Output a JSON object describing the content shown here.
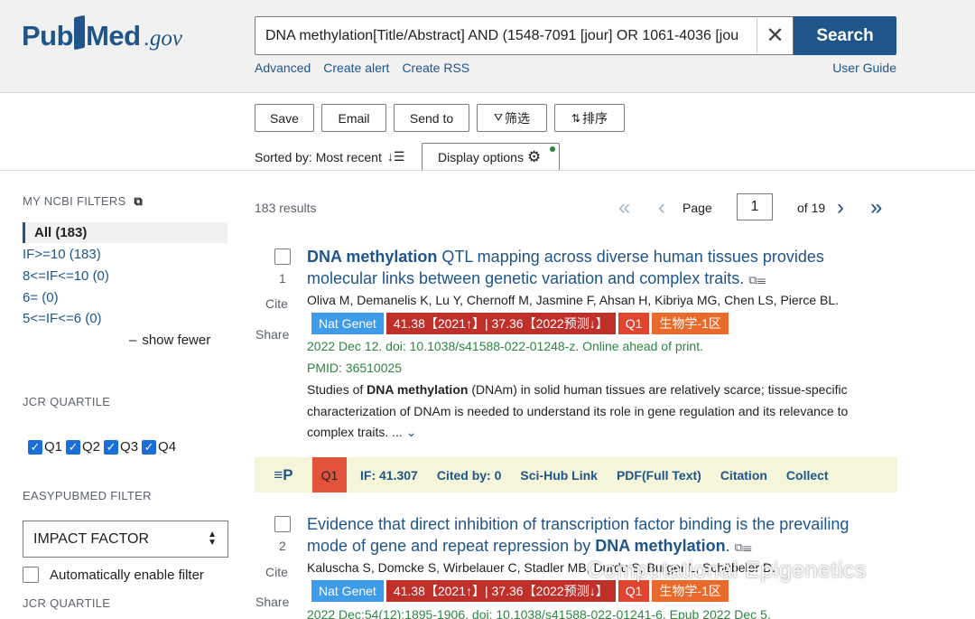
{
  "header": {
    "logo_pub": "Pub",
    "logo_med": "Med",
    "logo_gov": ".gov",
    "search_value": "DNA methylation[Title/Abstract] AND (1548-7091 [jour] OR 1061-4036 [jou",
    "search_button": "Search",
    "links": [
      "Advanced",
      "Create alert",
      "Create RSS"
    ],
    "user_guide": "User Guide"
  },
  "toolbar": {
    "buttons": [
      "Save",
      "Email",
      "Send to",
      "筛选",
      "排序"
    ],
    "sorted_by": "Sorted by: Most recent",
    "display_options": "Display options"
  },
  "sidebar": {
    "my_ncbi_title": "MY NCBI FILTERS",
    "filter_all": "All (183)",
    "filters": [
      "IF>=10 (183)",
      "8<=IF<=10 (0)",
      "6= (0)",
      "5<=IF<=6 (0)"
    ],
    "show_fewer": "show fewer",
    "jcr_title": "JCR QUARTILE",
    "quartiles": [
      "Q1",
      "Q2",
      "Q3",
      "Q4"
    ],
    "easypubmed_title": "EASYPUBMED FILTER",
    "select_value": "IMPACT FACTOR",
    "auto_filter": "Automatically enable filter",
    "jcr_title_2": "JCR QUARTILE"
  },
  "results": {
    "count": "183 results",
    "page_label": "Page",
    "page_value": "1",
    "of_pages": "of 19"
  },
  "articles": [
    {
      "num": "1",
      "cite": "Cite",
      "share": "Share",
      "title_bold": "DNA methylation",
      "title_rest": " QTL mapping across diverse human tissues provides molecular links between genetic variation and complex traits.",
      "authors": "Oliva M, Demanelis K, Lu Y, Chernoff M, Jasmine F, Ahsan H, Kibriya MG, Chen LS, Pierce BL.",
      "badge_journal": "Nat Genet",
      "badge_if": "41.38【2021↑】| 37.36【2022预测↓】",
      "badge_q": "Q1",
      "badge_zone": "生物学-1区",
      "citation": "2022 Dec 12. doi: 10.1038/s41588-022-01248-z. Online ahead of print.",
      "pmid": "PMID: 36510025",
      "snippet_pre": "Studies of ",
      "snippet_bold": "DNA methylation",
      "snippet_post": " (DNAm) in solid human tissues are relatively scarce; tissue-specific characterization of DNAm is needed to understand its role in gene regulation and its relevance to complex traits. ..."
    },
    {
      "num": "2",
      "cite": "Cite",
      "share": "Share",
      "title_pre": "Evidence that direct inhibition of transcription factor binding is the prevailing mode of gene and repeat repression by ",
      "title_bold": "DNA methylation",
      "title_end": ".",
      "authors": "Kaluscha S, Domcke S, Wirbelauer C, Stadler MB, Durdu S, Burger L, Schübeler D.",
      "badge_journal": "Nat Genet",
      "badge_if": "41.38【2021↑】| 37.36【2022预测↓】",
      "badge_q": "Q1",
      "badge_zone": "生物学-1区",
      "citation": "2022 Dec;54(12):1895-1906. doi: 10.1038/s41588-022-01241-6. Epub 2022 Dec 5."
    }
  ],
  "easybar": {
    "logo": "≡P",
    "q": "Q1",
    "if": "IF: 41.307",
    "cited": "Cited by: 0",
    "scihub": "Sci-Hub Link",
    "pdf": "PDF(Full Text)",
    "citation": "Citation",
    "collect": "Collect"
  },
  "watermark": "Computational Epigenetics",
  "colors": {
    "brand": "#20558a",
    "journal_badge": "#3d9bea",
    "if_badge": "#c0302b",
    "q_badge": "#e0452f",
    "zone_badge": "#e86a2c",
    "citation_green": "#2e8540"
  }
}
